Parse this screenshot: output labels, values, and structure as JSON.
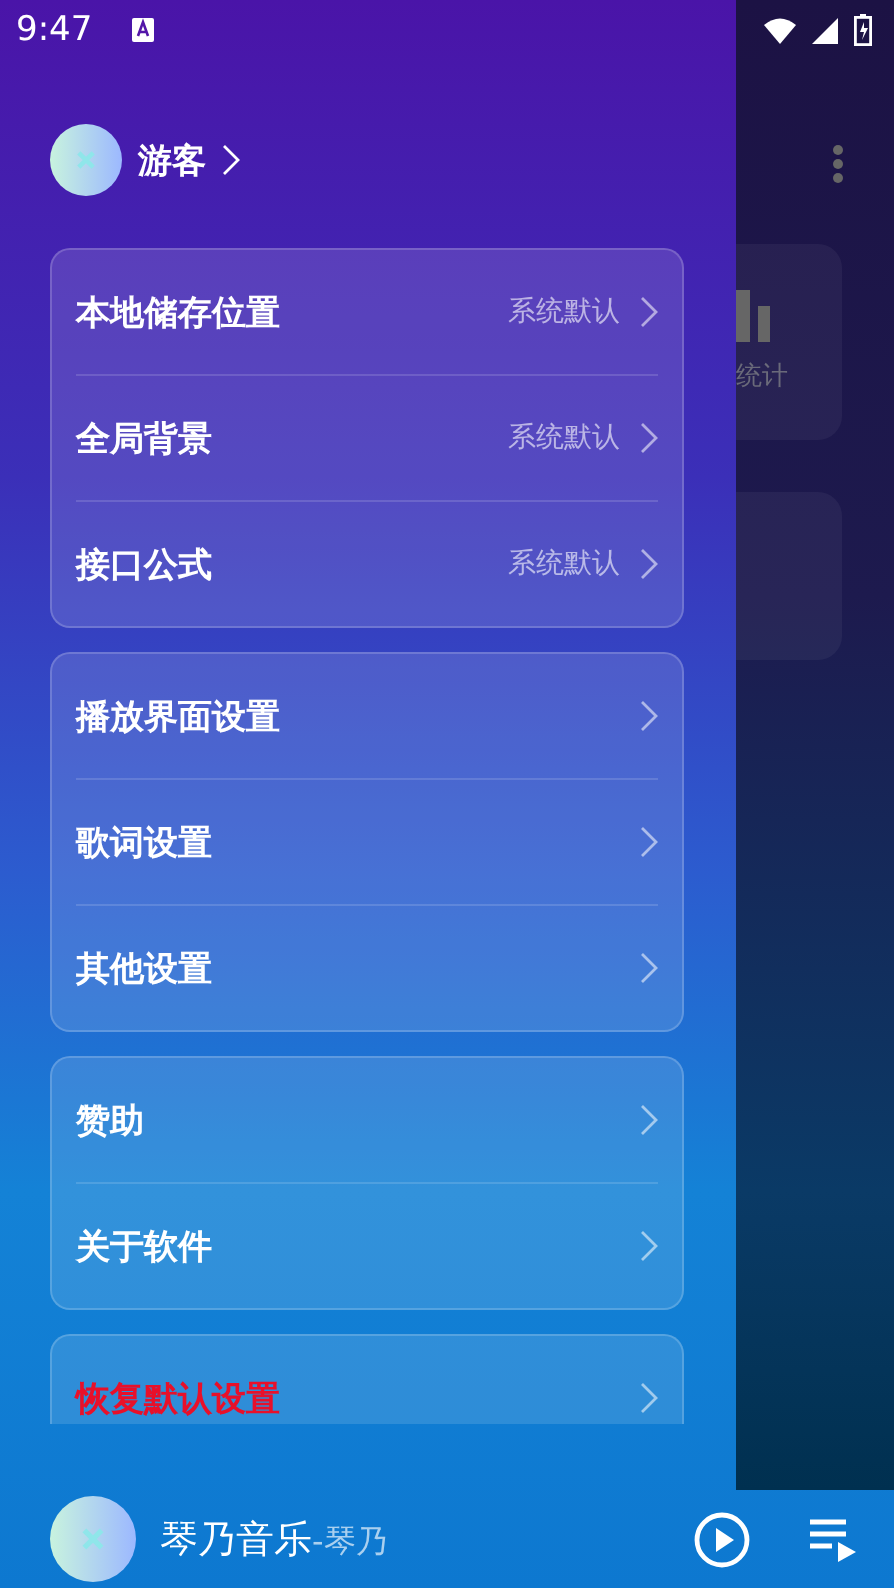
{
  "status_bar": {
    "time": "9:47"
  },
  "profile": {
    "name": "游客"
  },
  "settings_groups": [
    {
      "items": [
        {
          "kind": "normal",
          "label": "本地储存位置",
          "value": "系统默认"
        },
        {
          "kind": "normal",
          "label": "全局背景",
          "value": "系统默认"
        },
        {
          "kind": "normal",
          "label": "接口公式",
          "value": "系统默认"
        }
      ]
    },
    {
      "items": [
        {
          "kind": "normal",
          "label": "播放界面设置"
        },
        {
          "kind": "normal",
          "label": "歌词设置"
        },
        {
          "kind": "normal",
          "label": "其他设置"
        }
      ]
    },
    {
      "items": [
        {
          "kind": "normal",
          "label": "赞助"
        },
        {
          "kind": "normal",
          "label": "关于软件"
        }
      ]
    },
    {
      "items": [
        {
          "kind": "danger",
          "label": "恢复默认设置"
        }
      ]
    }
  ],
  "background_app": {
    "card_label": "统计"
  },
  "now_playing": {
    "title": "琴乃音乐",
    "subtitle": "-琴乃",
    "playing": false
  }
}
